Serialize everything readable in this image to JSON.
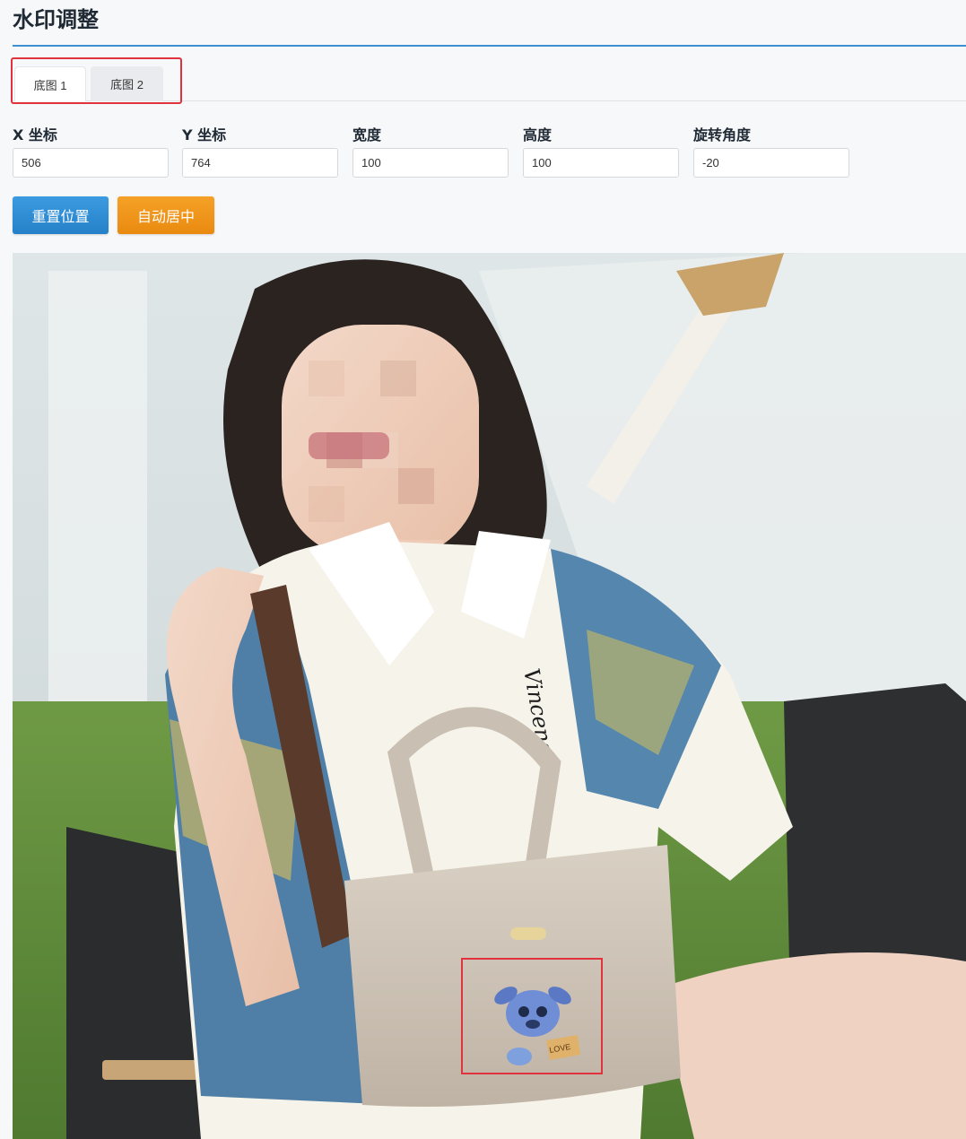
{
  "page": {
    "title": "水印调整"
  },
  "tabs": [
    {
      "label": "底图 1",
      "active": true
    },
    {
      "label": "底图 2",
      "active": false
    }
  ],
  "fields": {
    "x": {
      "label": "X 坐标",
      "value": "506"
    },
    "y": {
      "label": "Y 坐标",
      "value": "764"
    },
    "width": {
      "label": "宽度",
      "value": "100"
    },
    "height": {
      "label": "高度",
      "value": "100"
    },
    "rotation": {
      "label": "旋转角度",
      "value": "-20"
    }
  },
  "buttons": {
    "reset": "重置位置",
    "center": "自动居中"
  },
  "preview": {
    "shirt_text": "Vincens",
    "watermark_text": "LOVE"
  },
  "colors": {
    "accent": "#3d8fd0",
    "reset_button": "#2a87cf",
    "center_button": "#f0931a",
    "highlight": "#e0333d"
  }
}
